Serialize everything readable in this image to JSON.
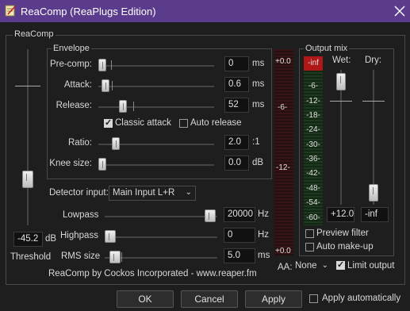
{
  "window": {
    "title": "ReaComp (ReaPlugs Edition)"
  },
  "main_group": {
    "label": "ReaComp"
  },
  "envelope": {
    "label": "Envelope",
    "precomp": {
      "label": "Pre-comp:",
      "value": "0",
      "unit": "ms"
    },
    "attack": {
      "label": "Attack:",
      "value": "0.6",
      "unit": "ms"
    },
    "release": {
      "label": "Release:",
      "value": "52",
      "unit": "ms"
    },
    "classic_attack": {
      "label": "Classic attack",
      "checked": true
    },
    "auto_release": {
      "label": "Auto release",
      "checked": false
    },
    "ratio": {
      "label": "Ratio:",
      "value": "2.0",
      "unit": ":1"
    },
    "knee": {
      "label": "Knee size:",
      "value": "0.0",
      "unit": "dB"
    }
  },
  "threshold": {
    "value": "-45.2",
    "unit": "dB",
    "label": "Threshold"
  },
  "detector": {
    "label": "Detector input:",
    "value": "Main Input L+R"
  },
  "lowpass": {
    "label": "Lowpass",
    "value": "20000",
    "unit": "Hz"
  },
  "highpass": {
    "label": "Highpass",
    "value": "0",
    "unit": "Hz"
  },
  "rms": {
    "label": "RMS size",
    "value": "5.0",
    "unit": "ms"
  },
  "credit": "ReaComp by Cockos Incorporated - www.reaper.fm",
  "gr_meter": {
    "labels": [
      "+0.0",
      "-6-",
      "-12-",
      "+0.0"
    ]
  },
  "output_mix": {
    "label": "Output mix",
    "meter_labels": [
      "-inf",
      "-6-",
      "-12-",
      "-18-",
      "-24-",
      "-30-",
      "-36-",
      "-42-",
      "-48-",
      "-54-",
      "-60-"
    ],
    "wet_label": "Wet:",
    "dry_label": "Dry:",
    "wet_value": "+12.0",
    "dry_value": "-inf",
    "preview_filter": {
      "label": "Preview filter",
      "checked": false
    },
    "auto_makeup": {
      "label": "Auto make-up",
      "checked": false
    },
    "limit_output": {
      "label": "Limit output",
      "checked": true
    }
  },
  "aa": {
    "label": "AA:",
    "value": "None"
  },
  "footer": {
    "ok": "OK",
    "cancel": "Cancel",
    "apply": "Apply",
    "apply_auto": {
      "label": "Apply automatically",
      "checked": false
    }
  },
  "colors": {
    "titlebar": "#5a3b8c",
    "meter_red": "#7a1a1a",
    "meter_green": "#2a6a2a",
    "peak_red": "#b01818"
  }
}
